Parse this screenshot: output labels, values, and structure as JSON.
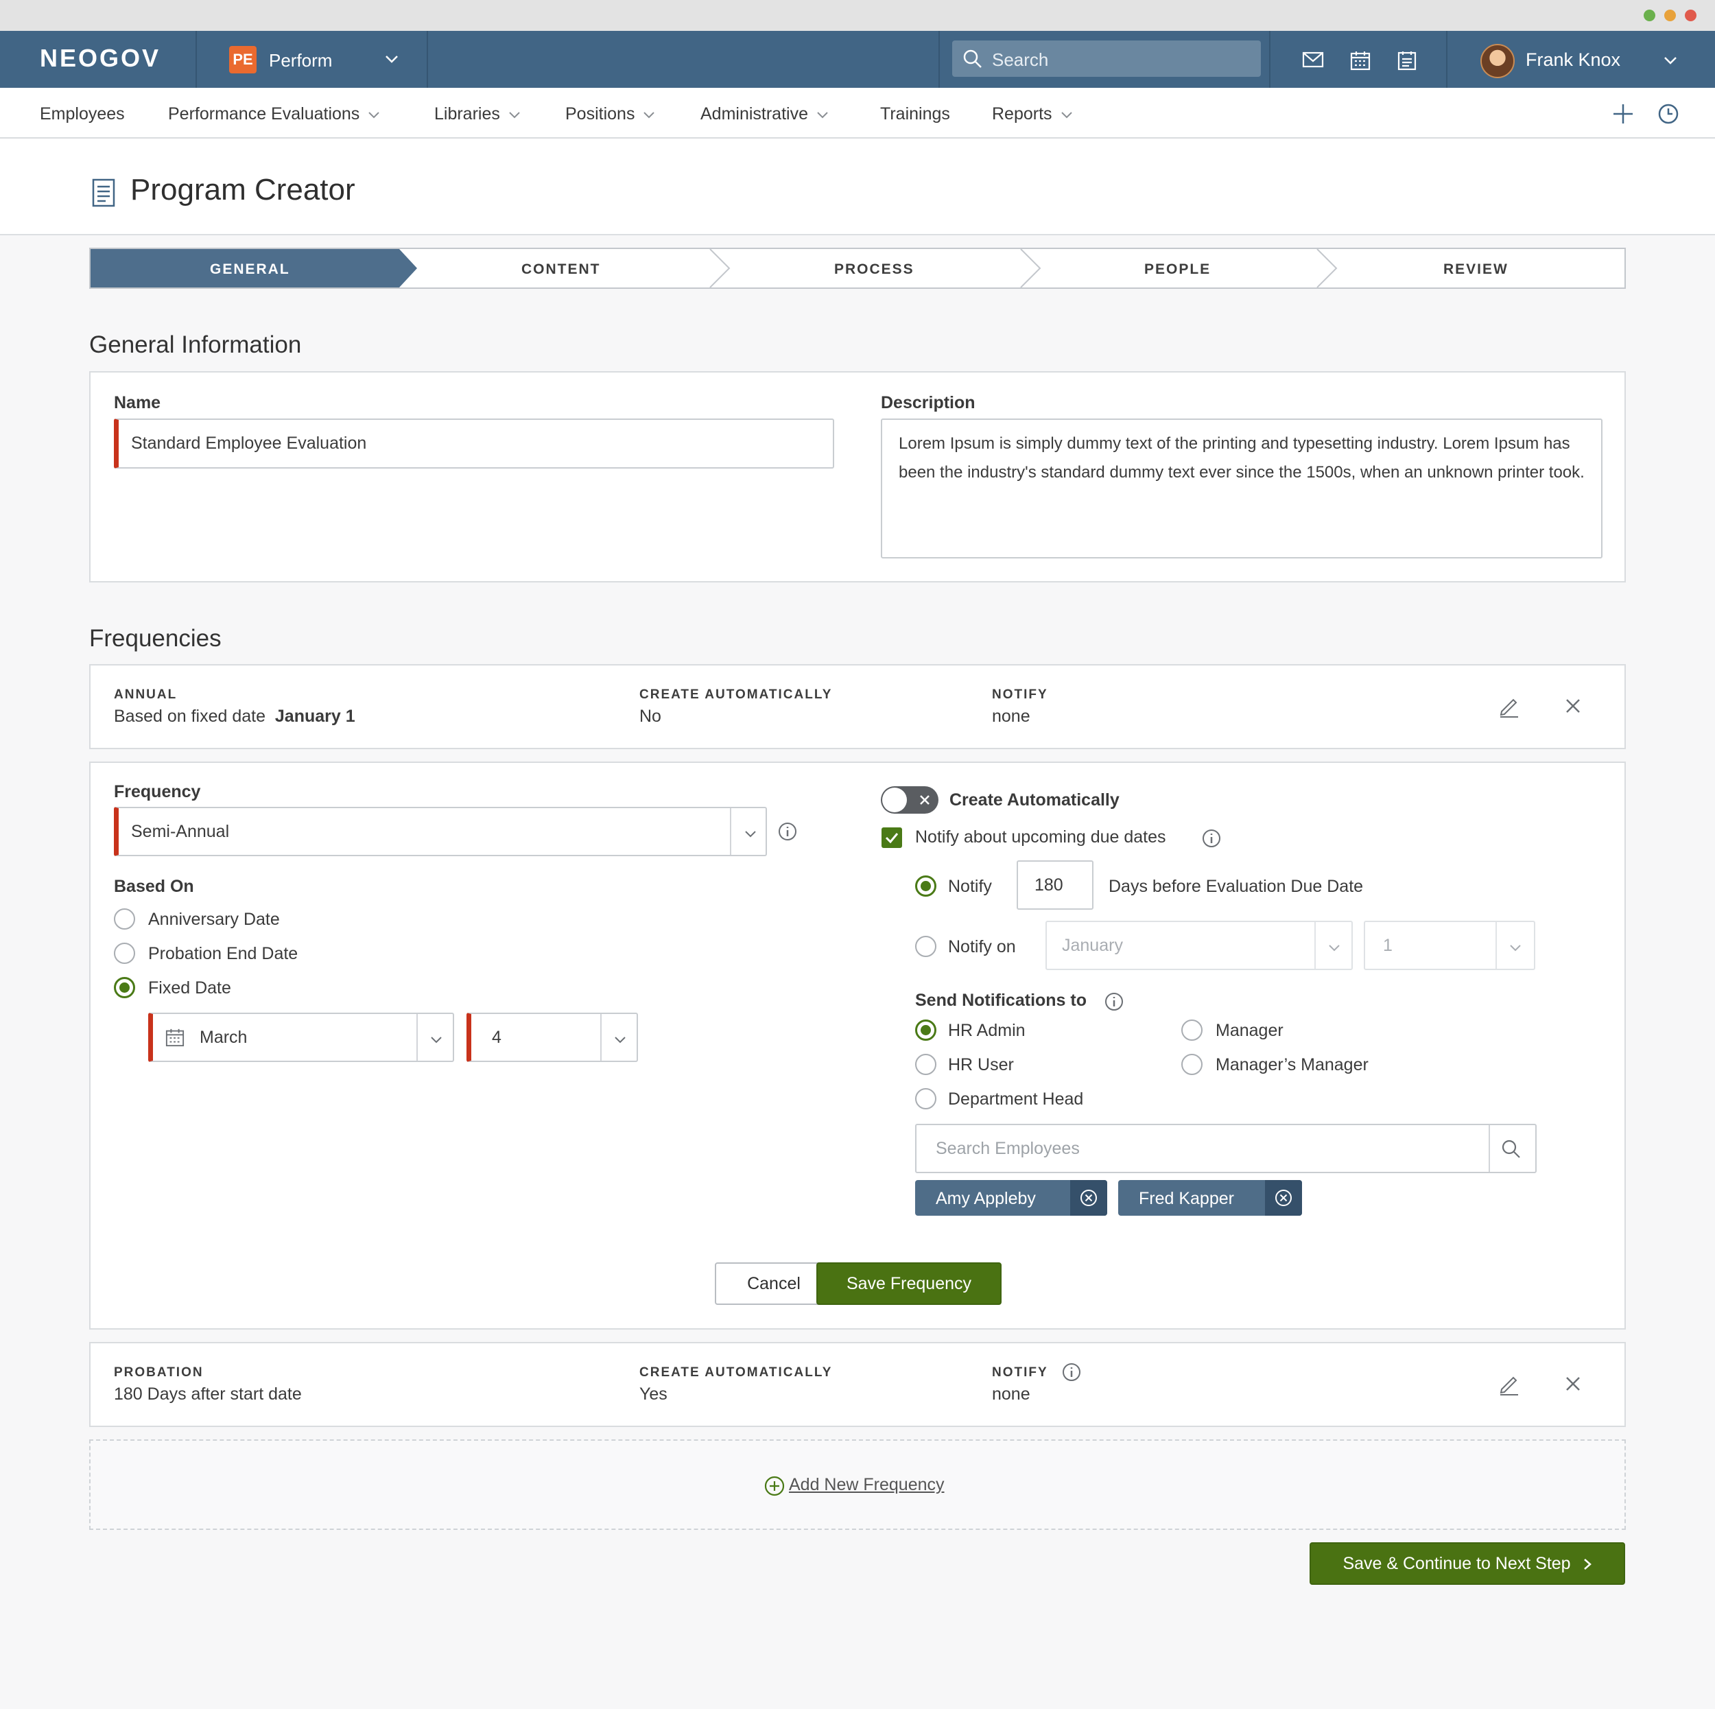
{
  "topnav": {
    "logo": "NEOGOV",
    "module_badge": "PE",
    "module_name": "Perform",
    "search_placeholder": "Search",
    "user_name": "Frank Knox"
  },
  "subnav": {
    "items": [
      "Employees",
      "Performance Evaluations",
      "Libraries",
      "Positions",
      "Administrative",
      "Trainings",
      "Reports"
    ]
  },
  "page": {
    "title": "Program Creator"
  },
  "stepper": {
    "steps": [
      "GENERAL",
      "CONTENT",
      "PROCESS",
      "PEOPLE",
      "REVIEW"
    ],
    "active": "GENERAL"
  },
  "general": {
    "section_title": "General Information",
    "name_label": "Name",
    "name_value": "Standard Employee Evaluation",
    "description_label": "Description",
    "description_value": "Lorem Ipsum is simply dummy text of the printing and typesetting industry. Lorem Ipsum has been the industry's standard dummy text ever since the 1500s, when an unknown printer took."
  },
  "frequencies": {
    "section_title": "Frequencies",
    "summary_annual": {
      "type_cap": "ANNUAL",
      "type_prefix": "Based on fixed date",
      "type_date": "January 1",
      "auto_cap": "CREATE AUTOMATICALLY",
      "auto_value": "No",
      "notify_cap": "NOTIFY",
      "notify_value": "none"
    },
    "editor": {
      "frequency_label": "Frequency",
      "frequency_value": "Semi-Annual",
      "based_on_label": "Based On",
      "based_on_options": [
        "Anniversary Date",
        "Probation End Date",
        "Fixed Date"
      ],
      "based_on_selected": "Fixed Date",
      "fixed_month": "March",
      "fixed_day": "4",
      "create_auto_label": "Create Automatically",
      "create_auto_on": false,
      "notify_due_label": "Notify about upcoming due dates",
      "notify_due_checked": true,
      "notify_label": "Notify",
      "notify_days": "180",
      "notify_days_suffix": "Days before Evaluation Due Date",
      "notify_on_label": "Notify on",
      "notify_on_month": "January",
      "notify_on_day": "1",
      "send_to_label": "Send Notifications to",
      "recipients": [
        "HR Admin",
        "HR User",
        "Department Head",
        "Manager",
        "Manager’s Manager"
      ],
      "recipient_selected": "HR Admin",
      "search_placeholder": "Search Employees",
      "chips": [
        "Amy Appleby",
        "Fred Kapper"
      ],
      "cancel_label": "Cancel",
      "save_label": "Save Frequency"
    },
    "summary_probation": {
      "type_cap": "PROBATION",
      "type_value": "180 Days after start date",
      "auto_cap": "CREATE AUTOMATICALLY",
      "auto_value": "Yes",
      "notify_cap": "NOTIFY",
      "notify_value": "none"
    },
    "add_new_label": "Add New Frequency"
  },
  "footer": {
    "continue_label": "Save & Continue to Next Step"
  },
  "colors": {
    "nav_blue": "#416585",
    "accent_green": "#4a7212",
    "required_red": "#c8321b",
    "badge_orange": "#ea6a2f"
  }
}
